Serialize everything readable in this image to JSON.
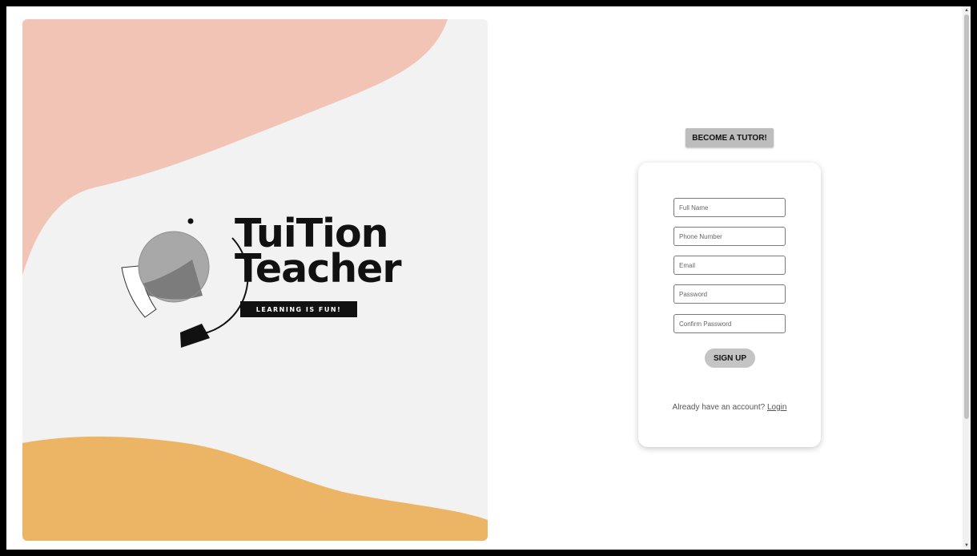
{
  "brand": {
    "title_line1": "TuiTion",
    "title_line2": "Teacher",
    "tagline": "LEARNING IS FUN!"
  },
  "header": {
    "tutor_button_label": "BECOME A TUTOR!"
  },
  "signup_form": {
    "fields": [
      {
        "placeholder": "Full Name",
        "value": ""
      },
      {
        "placeholder": "Phone Number",
        "value": ""
      },
      {
        "placeholder": "Email",
        "value": ""
      },
      {
        "placeholder": "Password",
        "value": ""
      },
      {
        "placeholder": "Confirm Password",
        "value": ""
      }
    ],
    "submit_label": "SIGN UP",
    "login_prompt": "Already have an account?",
    "login_link": "Login"
  },
  "colors": {
    "pink_blob": "#f2c4b6",
    "orange_blob": "#ebb565",
    "art_background": "#f2f2f2",
    "button_gray": "#bdbdbd"
  }
}
